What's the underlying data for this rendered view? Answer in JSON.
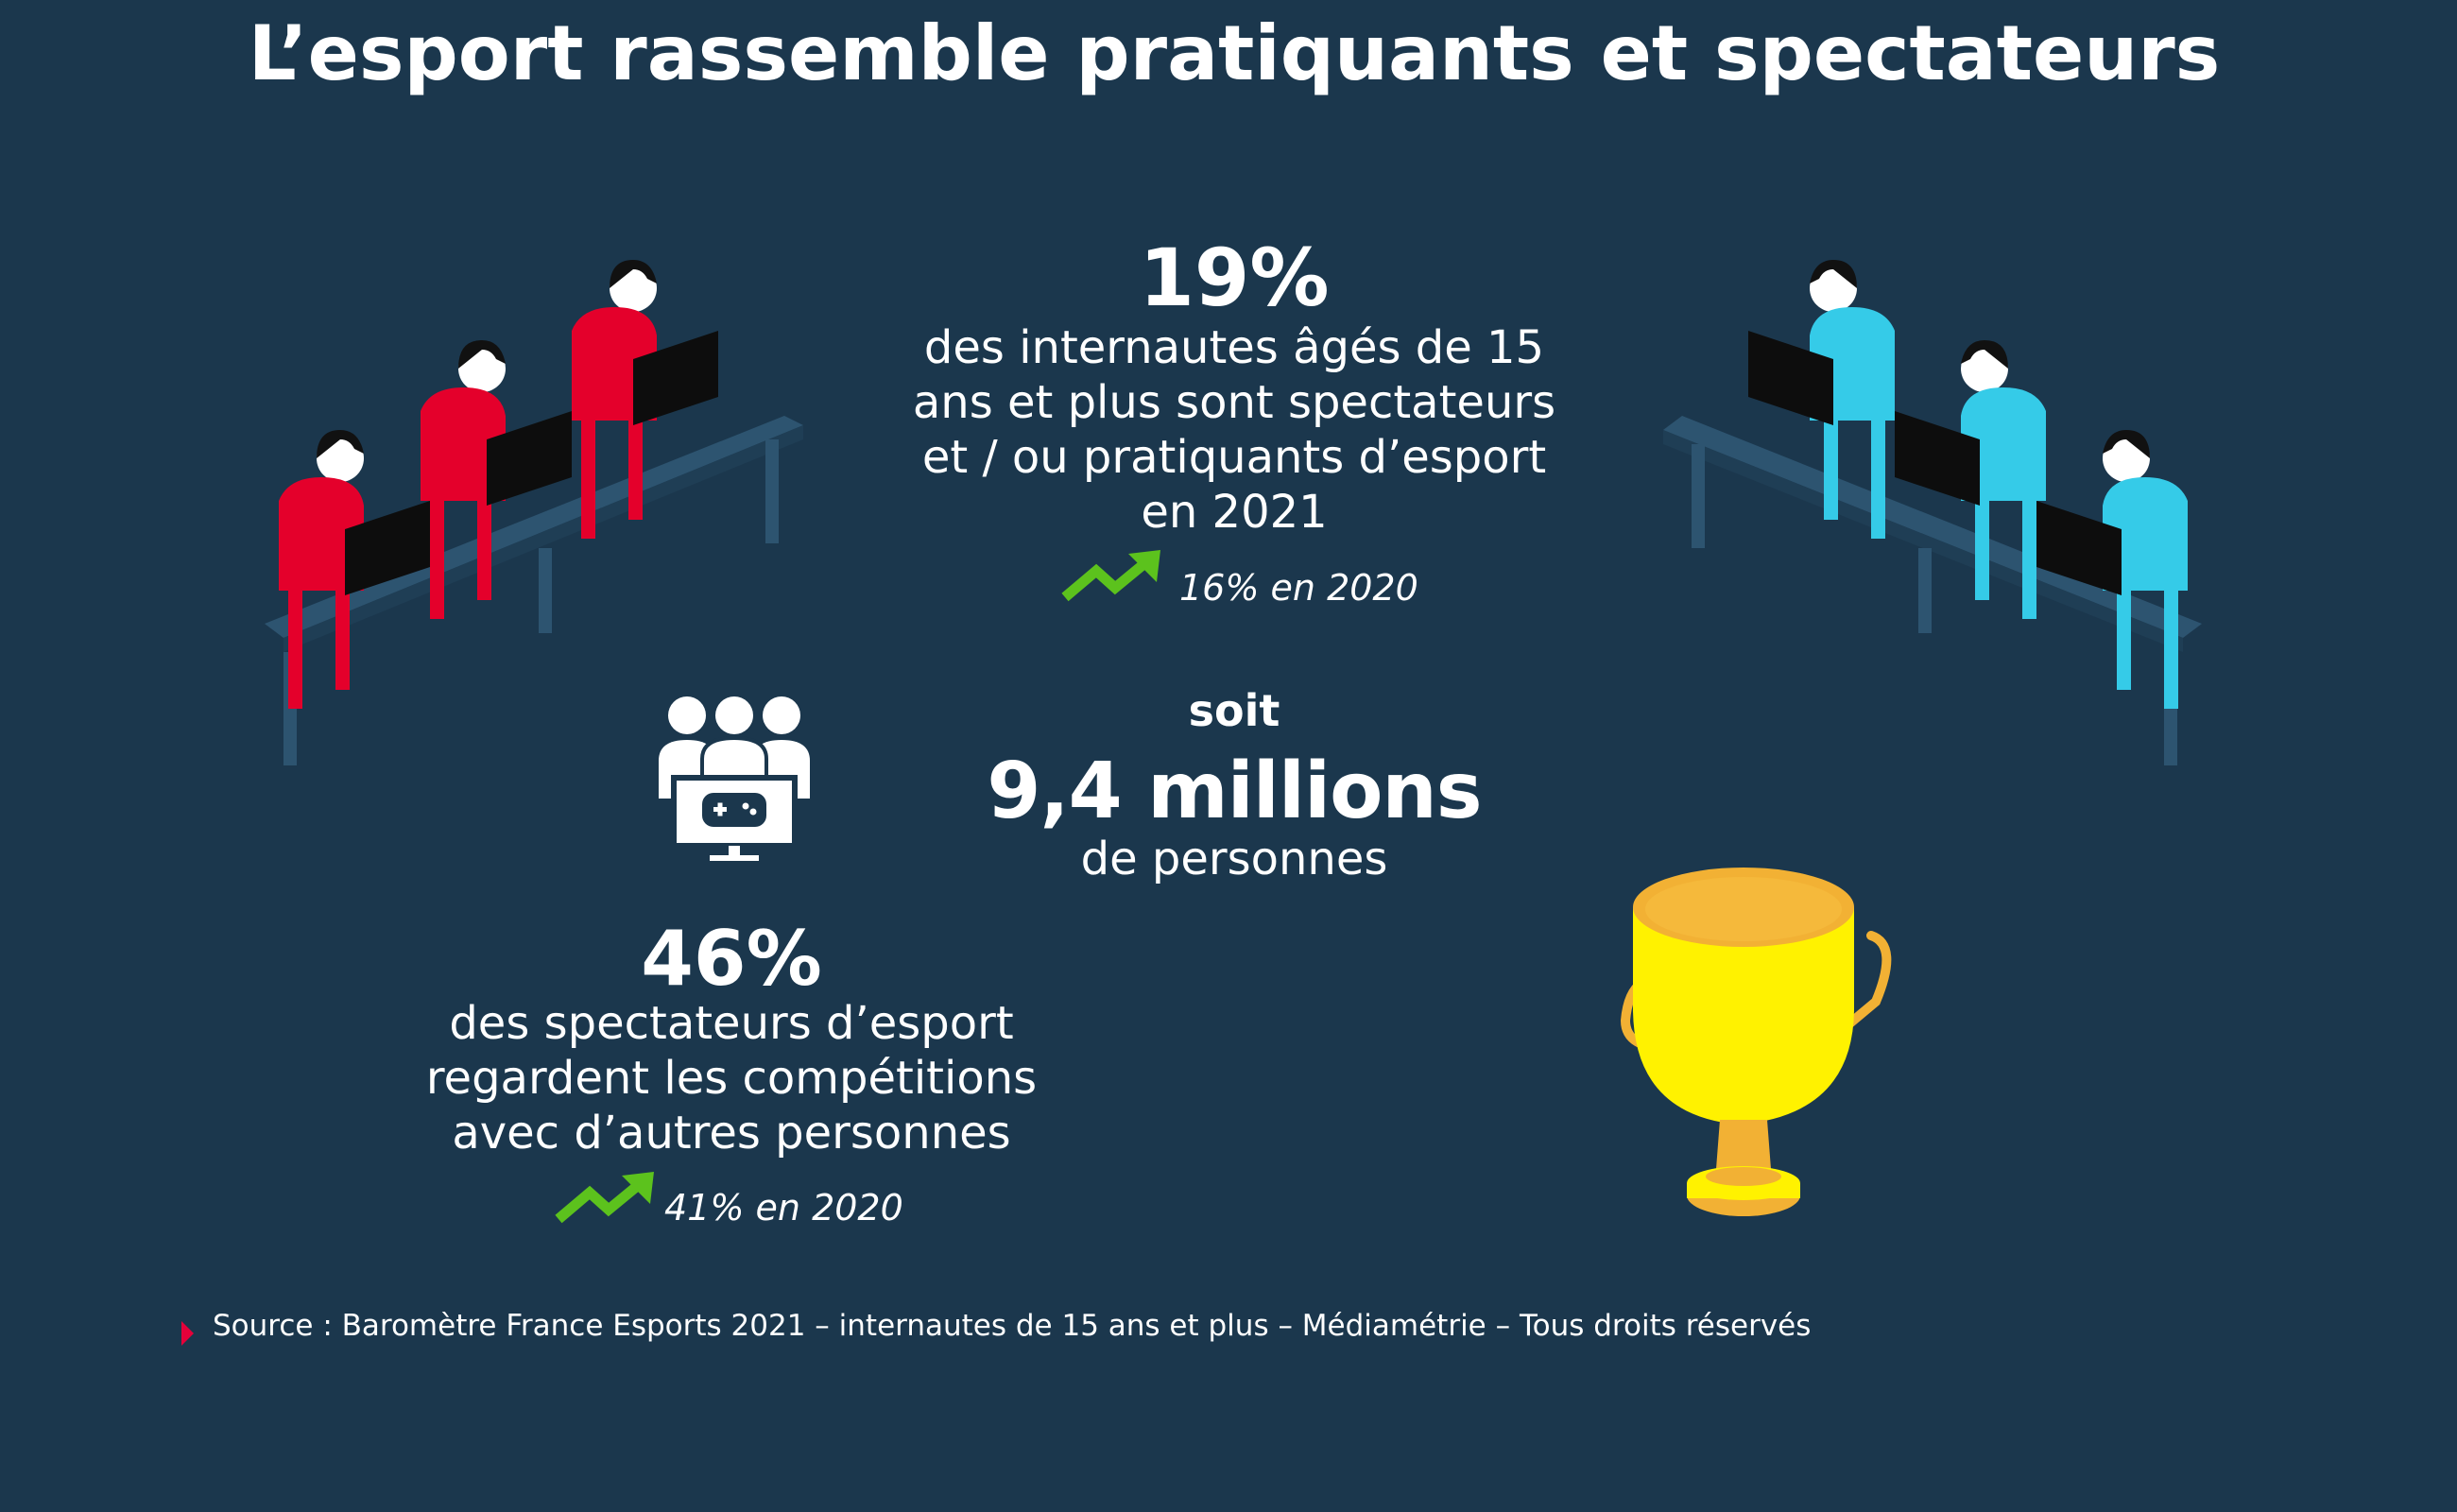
{
  "title": "L’esport rassemble pratiquants et spectateurs",
  "stat_main": {
    "value": "19%",
    "lines": [
      "des internautes âgés de 15",
      "ans et plus sont spectateurs",
      "et / ou pratiquants d’esport",
      "en 2021"
    ],
    "trend": "16% en 2020"
  },
  "stat_people": {
    "prefix": "soit",
    "value": "9,4 millions",
    "suffix": "de personnes"
  },
  "stat_group": {
    "value": "46%",
    "lines": [
      "des spectateurs d’esport",
      "regardent les compétitions",
      "avec d’autres personnes"
    ],
    "trend": "41% en 2020"
  },
  "source": "Source : Baromètre France Esports 2021 – internautes de 15 ans et plus – Médiamétrie – Tous droits réservés",
  "colors": {
    "background": "#1b374d",
    "team_left": "#e4002b",
    "team_right": "#35cbe8",
    "trend_arrow": "#5cc21d",
    "trophy": "#fff200",
    "source_marker": "#e5003a"
  },
  "icons": [
    "gamers-left-illustration",
    "gamers-right-illustration",
    "group-watching-icon",
    "trend-up-icon",
    "trophy-icon"
  ]
}
